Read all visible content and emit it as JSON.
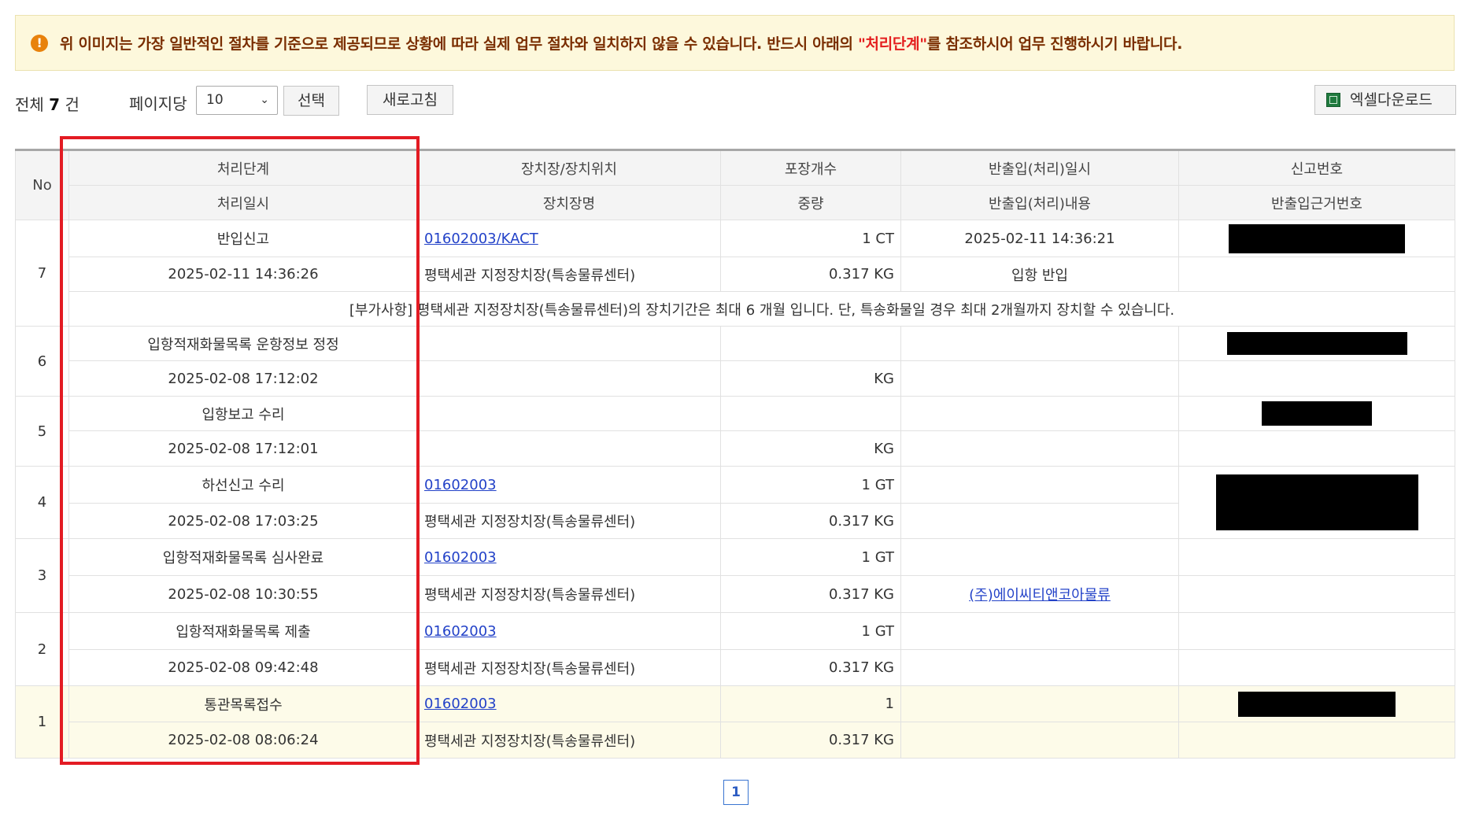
{
  "notice": {
    "icon": "exclamation-icon",
    "text_before": "위 이미지는 가장 일반적인 절차를 기준으로 제공되므로 상황에 따라 실제 업무 절차와 일치하지 않을 수 있습니다. 반드시 아래의 ",
    "highlight": "\"처리단계\"",
    "text_after": "를 참조하시어 업무 진행하시기 바랍니다."
  },
  "toolbar": {
    "total_prefix": "전체",
    "total_count": "7",
    "total_suffix": "건",
    "per_page_label": "페이지당",
    "per_page_value": "10",
    "select_label": "선택",
    "refresh_label": "새로고침",
    "excel_label": "엑셀다운로드",
    "excel_icon": "excel-icon"
  },
  "table": {
    "headers": {
      "no": "No",
      "row1": [
        "처리단계",
        "장치장/장치위치",
        "포장개수",
        "반출입(처리)일시",
        "신고번호"
      ],
      "row2": [
        "처리일시",
        "장치장명",
        "중량",
        "반출입(처리)내용",
        "반출입근거번호"
      ]
    },
    "rows": [
      {
        "no": "7",
        "stage": "반입신고",
        "datetime": "2025-02-11 14:36:26",
        "location": "01602003/KACT",
        "location_name": "평택세관 지정장치장(특송물류센터)",
        "packages": "1 CT",
        "weight": "0.317 KG",
        "io_datetime": "2025-02-11 14:36:21",
        "io_content": "입항 반입",
        "note": "[부가사항] 평택세관 지정장치장(특송물류센터)의 장치기간은 최대 6 개월 입니다. 단, 특송화물일 경우 최대 2개월까지 장치할 수 있습니다."
      },
      {
        "no": "6",
        "stage": "입항적재화물목록 운항정보 정정",
        "datetime": "2025-02-08 17:12:02",
        "location": "",
        "location_name": "",
        "packages": "",
        "weight": "KG",
        "io_datetime": "",
        "io_content": ""
      },
      {
        "no": "5",
        "stage": "입항보고 수리",
        "datetime": "2025-02-08 17:12:01",
        "location": "",
        "location_name": "",
        "packages": "",
        "weight": "KG",
        "io_datetime": "",
        "io_content": ""
      },
      {
        "no": "4",
        "stage": "하선신고 수리",
        "datetime": "2025-02-08 17:03:25",
        "location": "01602003",
        "location_name": "평택세관 지정장치장(특송물류센터)",
        "packages": "1 GT",
        "weight": "0.317 KG",
        "io_datetime": "",
        "io_content": ""
      },
      {
        "no": "3",
        "stage": "입항적재화물목록 심사완료",
        "datetime": "2025-02-08 10:30:55",
        "location": "01602003",
        "location_name": "평택세관 지정장치장(특송물류센터)",
        "packages": "1 GT",
        "weight": "0.317 KG",
        "io_datetime": "",
        "io_content": "(주)에이씨티앤코아물류"
      },
      {
        "no": "2",
        "stage": "입항적재화물목록 제출",
        "datetime": "2025-02-08 09:42:48",
        "location": "01602003",
        "location_name": "평택세관 지정장치장(특송물류센터)",
        "packages": "1 GT",
        "weight": "0.317 KG",
        "io_datetime": "",
        "io_content": ""
      },
      {
        "no": "1",
        "stage": "통관목록접수",
        "datetime": "2025-02-08 08:06:24",
        "location": "01602003",
        "location_name": "평택세관 지정장치장(특송물류센터)",
        "packages": "1",
        "weight": "0.317 KG",
        "io_datetime": "",
        "io_content": ""
      }
    ]
  },
  "pagination": {
    "current": "1"
  },
  "colors": {
    "notice_bg": "#fdf8dc",
    "notice_text": "#7a2e00",
    "highlight_text": "#e41e1e",
    "link": "#2342c8",
    "annotation_box": "#e31b23",
    "last_row_bg": "#fdfbe9"
  }
}
